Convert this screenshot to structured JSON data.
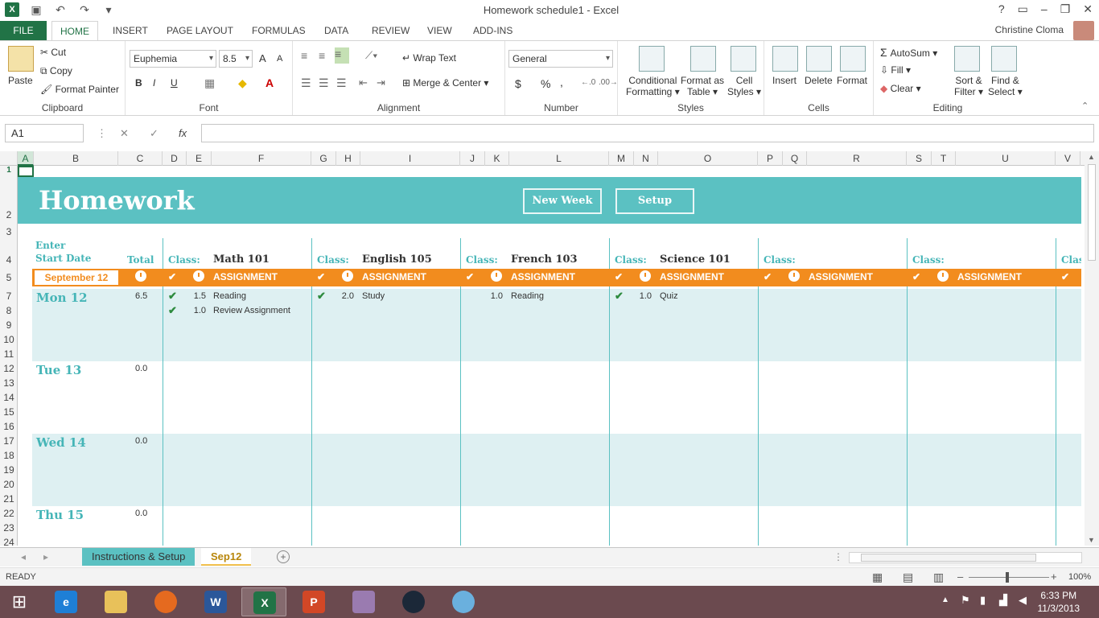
{
  "window": {
    "title": "Homework schedule1 - Excel",
    "help": "?"
  },
  "qat": {
    "save": "save-icon",
    "undo": "undo-icon",
    "redo": "redo-icon"
  },
  "tabs": [
    "FILE",
    "HOME",
    "INSERT",
    "PAGE LAYOUT",
    "FORMULAS",
    "DATA",
    "REVIEW",
    "VIEW",
    "ADD-INS"
  ],
  "user": {
    "name": "Christine Cloma"
  },
  "ribbon": {
    "clipboard": {
      "label": "Clipboard",
      "paste": "Paste",
      "cut": "Cut",
      "copy": "Copy",
      "format_painter": "Format Painter"
    },
    "font": {
      "label": "Font",
      "name": "Euphemia",
      "size": "8.5",
      "bold": "B",
      "italic": "I",
      "underline": "U",
      "inc": "A",
      "dec": "A"
    },
    "alignment": {
      "label": "Alignment",
      "wrap": "Wrap Text",
      "merge": "Merge & Center"
    },
    "number": {
      "label": "Number",
      "format": "General",
      "currency": "$",
      "percent": "%",
      "comma": ","
    },
    "styles": {
      "label": "Styles",
      "conditional": "Conditional",
      "conditional2": "Formatting",
      "table": "Format as",
      "table2": "Table",
      "cell": "Cell",
      "cell2": "Styles"
    },
    "cells": {
      "label": "Cells",
      "insert": "Insert",
      "delete": "Delete",
      "format": "Format"
    },
    "editing": {
      "label": "Editing",
      "autosum": "AutoSum",
      "fill": "Fill",
      "clear": "Clear",
      "sort": "Sort &",
      "sort2": "Filter",
      "find": "Find &",
      "find2": "Select"
    }
  },
  "formula_bar": {
    "name_box": "A1",
    "cancel": "✕",
    "enter": "✓",
    "fx": "fx",
    "value": ""
  },
  "columns": [
    "A",
    "B",
    "C",
    "D",
    "E",
    "F",
    "G",
    "H",
    "I",
    "J",
    "K",
    "L",
    "M",
    "N",
    "O",
    "P",
    "Q",
    "R",
    "S",
    "T",
    "U",
    "V"
  ],
  "rows": [
    "1",
    "2",
    "3",
    "4",
    "5",
    "7",
    "8",
    "9",
    "10",
    "11",
    "12",
    "13",
    "14",
    "15",
    "16",
    "17",
    "18",
    "19",
    "20",
    "21",
    "22",
    "23",
    "24"
  ],
  "sheet": {
    "title": "Homework",
    "btn_new_week": "New Week",
    "btn_setup": "Setup",
    "enter_line1": "Enter",
    "enter_line2": "Start Date",
    "total_label": "Total",
    "start_date": "September  12",
    "assignment_header": "ASSIGNMENT",
    "class_label": "Class:",
    "class_label_cut": "Clas",
    "classes": [
      "Math  101",
      "English  105",
      "French  103",
      "Science  101",
      "",
      ""
    ],
    "days": [
      {
        "name": "Mon 12",
        "total": "6.5"
      },
      {
        "name": "Tue 13",
        "total": "0.0"
      },
      {
        "name": "Wed 14",
        "total": "0.0"
      },
      {
        "name": "Thu 15",
        "total": "0.0"
      }
    ],
    "entries": [
      {
        "hours": "1.5",
        "text": "Reading"
      },
      {
        "hours": "1.0",
        "text": "Review  Assignment"
      },
      {
        "hours": "2.0",
        "text": "Study"
      },
      {
        "hours": "1.0",
        "text": "Reading"
      },
      {
        "hours": "1.0",
        "text": "Quiz"
      }
    ]
  },
  "sheet_tabs": [
    "Instructions & Setup",
    "Sep12"
  ],
  "status": {
    "ready": "READY",
    "zoom": "100%"
  },
  "taskbar": {
    "time": "6:33 PM",
    "date": "11/3/2013"
  }
}
